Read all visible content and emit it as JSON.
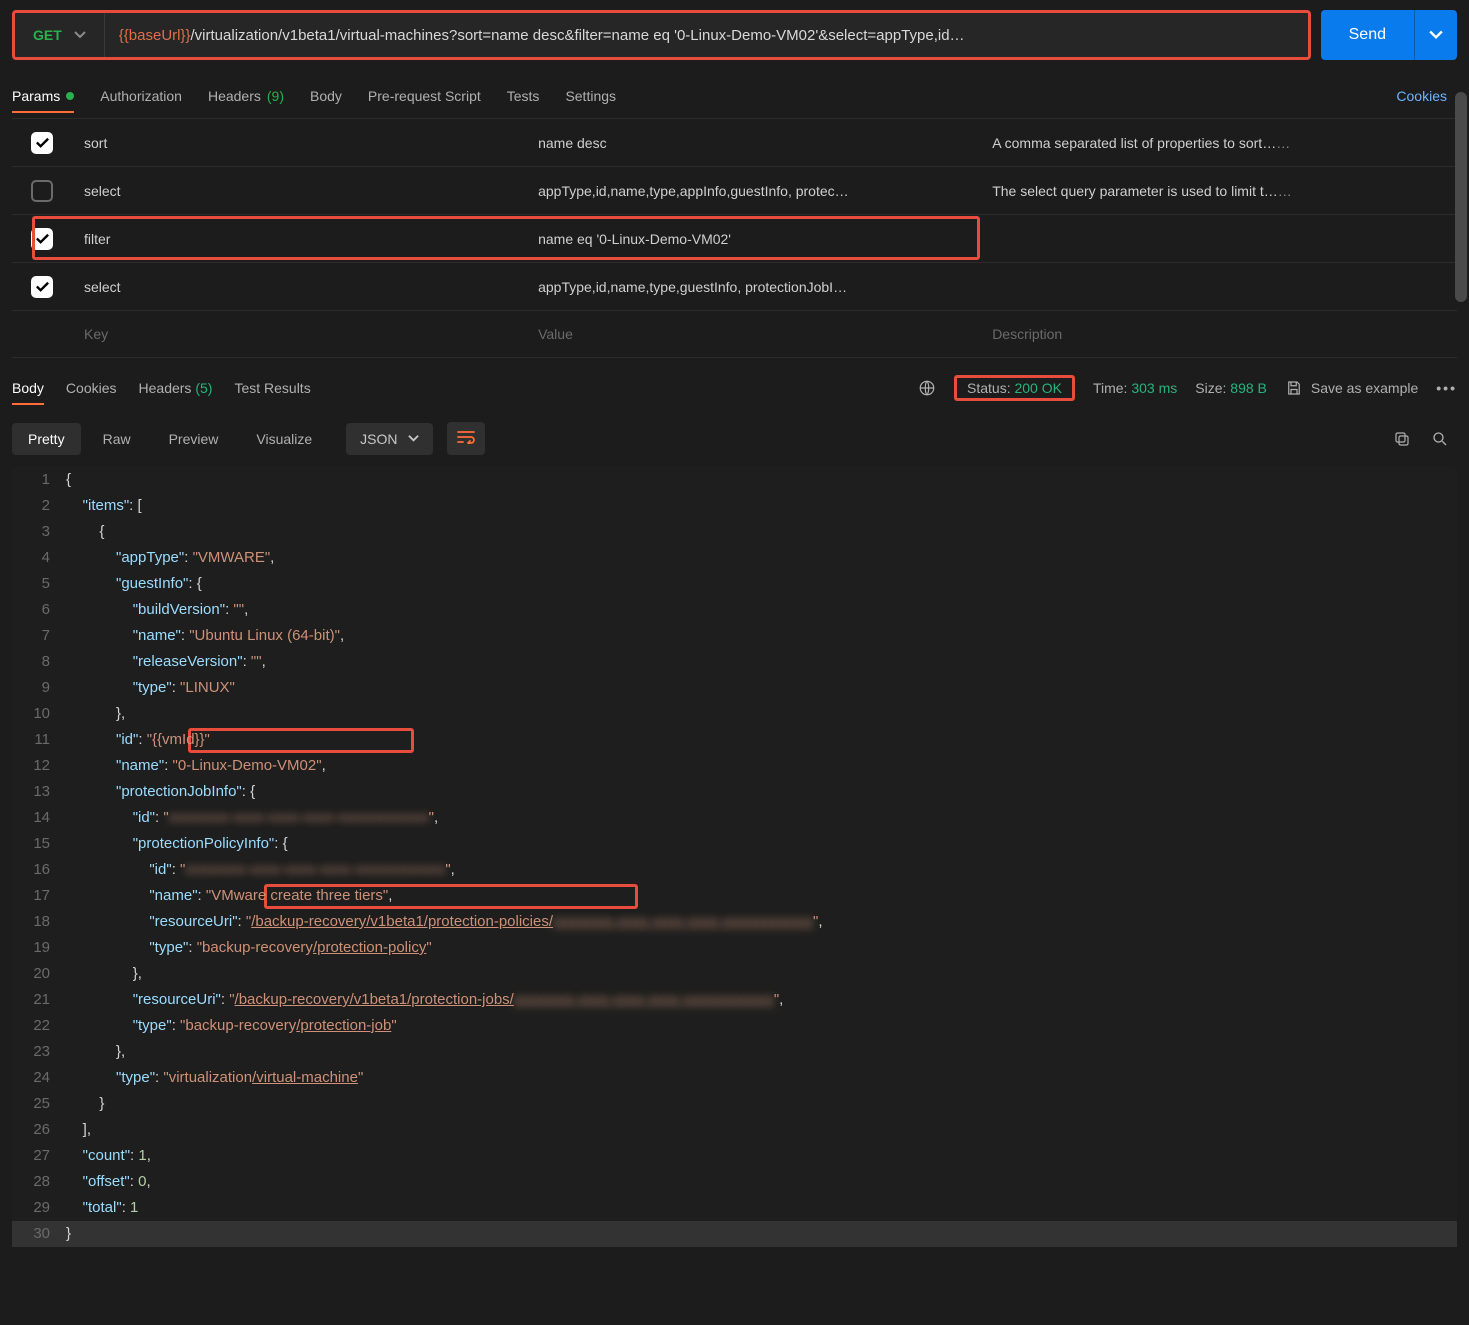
{
  "request": {
    "method": "GET",
    "url_var": "{{baseUrl}}",
    "url_rest": "/virtualization/v1beta1/virtual-machines?sort=name desc&filter=name eq '0-Linux-Demo-VM02'&select=appType,id…",
    "send": "Send"
  },
  "req_tabs": {
    "params": "Params",
    "auth": "Authorization",
    "headers": "Headers",
    "headers_badge": "(9)",
    "body": "Body",
    "pre": "Pre-request Script",
    "tests": "Tests",
    "settings": "Settings",
    "cookies": "Cookies"
  },
  "params": [
    {
      "checked": true,
      "key": "sort",
      "value": "name desc",
      "desc": "A comma separated list of properties to sort…",
      "trail": "…"
    },
    {
      "checked": false,
      "key": "select",
      "value": "appType,id,name,type,appInfo,guestInfo, protec…",
      "desc": "The select query parameter is used to limit t…",
      "trail": "…"
    },
    {
      "checked": true,
      "key": "filter",
      "value": "name eq '0-Linux-Demo-VM02'",
      "desc": "",
      "trail": ""
    },
    {
      "checked": true,
      "key": "select",
      "value": "appType,id,name,type,guestInfo, protectionJobI…",
      "desc": "",
      "trail": ""
    }
  ],
  "placeholder_row": {
    "key": "Key",
    "value": "Value",
    "desc": "Description"
  },
  "resp_tabs": {
    "body": "Body",
    "cookies": "Cookies",
    "headers": "Headers",
    "headers_badge": "(5)",
    "tests": "Test Results"
  },
  "resp_meta": {
    "status_label": "Status:",
    "status_val": "200 OK",
    "time_label": "Time:",
    "time_val": "303 ms",
    "size_label": "Size:",
    "size_val": "898 B",
    "save": "Save as example"
  },
  "view_tabs": {
    "pretty": "Pretty",
    "raw": "Raw",
    "preview": "Preview",
    "visualize": "Visualize",
    "format": "JSON"
  },
  "json_lines": [
    {
      "n": 1,
      "html": "<span class='p'>{</span>"
    },
    {
      "n": 2,
      "html": "    <span class='k'>\"items\"</span><span class='p'>: [</span>"
    },
    {
      "n": 3,
      "html": "        <span class='p'>{</span>"
    },
    {
      "n": 4,
      "html": "            <span class='k'>\"appType\"</span><span class='p'>: </span><span class='s'>\"VMWARE\"</span><span class='p'>,</span>"
    },
    {
      "n": 5,
      "html": "            <span class='k'>\"guestInfo\"</span><span class='p'>: {</span>"
    },
    {
      "n": 6,
      "html": "                <span class='k'>\"buildVersion\"</span><span class='p'>: </span><span class='s'>\"\"</span><span class='p'>,</span>"
    },
    {
      "n": 7,
      "html": "                <span class='k'>\"name\"</span><span class='p'>: </span><span class='s'>\"Ubuntu Linux (64-bit)\"</span><span class='p'>,</span>"
    },
    {
      "n": 8,
      "html": "                <span class='k'>\"releaseVersion\"</span><span class='p'>: </span><span class='s'>\"\"</span><span class='p'>,</span>"
    },
    {
      "n": 9,
      "html": "                <span class='k'>\"type\"</span><span class='p'>: </span><span class='s'>\"LINUX\"</span>"
    },
    {
      "n": 10,
      "html": "            <span class='p'>},</span>"
    },
    {
      "n": 11,
      "html": "            <span class='k'>\"id\"</span><span class='p'>: </span><span class='s'>\"{{vmId}}\"</span>"
    },
    {
      "n": 12,
      "html": "            <span class='k'>\"name\"</span><span class='p'>: </span><span class='s'>\"0-Linux-Demo-VM02\"</span><span class='p'>,</span>"
    },
    {
      "n": 13,
      "html": "            <span class='k'>\"protectionJobInfo\"</span><span class='p'>: {</span>"
    },
    {
      "n": 14,
      "html": "                <span class='k'>\"id\"</span><span class='p'>: </span><span class='s'>\"<span class='redact'>xxxxxxxx-xxxx-xxxx-xxxx-xxxxxxxxxxxx</span>\"</span><span class='p'>,</span>"
    },
    {
      "n": 15,
      "html": "                <span class='k'>\"protectionPolicyInfo\"</span><span class='p'>: {</span>"
    },
    {
      "n": 16,
      "html": "                    <span class='k'>\"id\"</span><span class='p'>: </span><span class='s'>\"<span class='redact'>xxxxxxxx-xxxx-xxxx-xxxx-xxxxxxxxxxxx</span>\"</span><span class='p'>,</span>"
    },
    {
      "n": 17,
      "html": "                    <span class='k'>\"name\"</span><span class='p'>: </span><span class='s'>\"VMware create three tiers\"</span><span class='p'>,</span>"
    },
    {
      "n": 18,
      "html": "                    <span class='k'>\"resourceUri\"</span><span class='p'>: </span><span class='s'>\"<span class='u'>/backup-recovery/v1beta1/protection-policies/</span><span class='redact u'>xxxxxxxx-xxxx-xxxx-xxxx-xxxxxxxxxxxx</span>\"</span><span class='p'>,</span>"
    },
    {
      "n": 19,
      "html": "                    <span class='k'>\"type\"</span><span class='p'>: </span><span class='s'>\"backup-recovery<span class='u'>/protection-policy</span>\"</span>"
    },
    {
      "n": 20,
      "html": "                <span class='p'>},</span>"
    },
    {
      "n": 21,
      "html": "                <span class='k'>\"resourceUri\"</span><span class='p'>: </span><span class='s'>\"<span class='u'>/backup-recovery/v1beta1/protection-jobs/</span><span class='redact u'>xxxxxxxx-xxxx-xxxx-xxxx-xxxxxxxxxxxx</span>\"</span><span class='p'>,</span>"
    },
    {
      "n": 22,
      "html": "                <span class='k'>\"type\"</span><span class='p'>: </span><span class='s'>\"backup-recovery<span class='u'>/protection-job</span>\"</span>"
    },
    {
      "n": 23,
      "html": "            <span class='p'>},</span>"
    },
    {
      "n": 24,
      "html": "            <span class='k'>\"type\"</span><span class='p'>: </span><span class='s'>\"virtualization<span class='u'>/virtual-machine</span>\"</span>"
    },
    {
      "n": 25,
      "html": "        <span class='p'>}</span>"
    },
    {
      "n": 26,
      "html": "    <span class='p'>],</span>"
    },
    {
      "n": 27,
      "html": "    <span class='k'>\"count\"</span><span class='p'>: </span><span class='n'>1</span><span class='p'>,</span>"
    },
    {
      "n": 28,
      "html": "    <span class='k'>\"offset\"</span><span class='p'>: </span><span class='n'>0</span><span class='p'>,</span>"
    },
    {
      "n": 29,
      "html": "    <span class='k'>\"total\"</span><span class='p'>: </span><span class='n'>1</span>"
    },
    {
      "n": 30,
      "html": "<span class='p'>}</span>"
    }
  ]
}
